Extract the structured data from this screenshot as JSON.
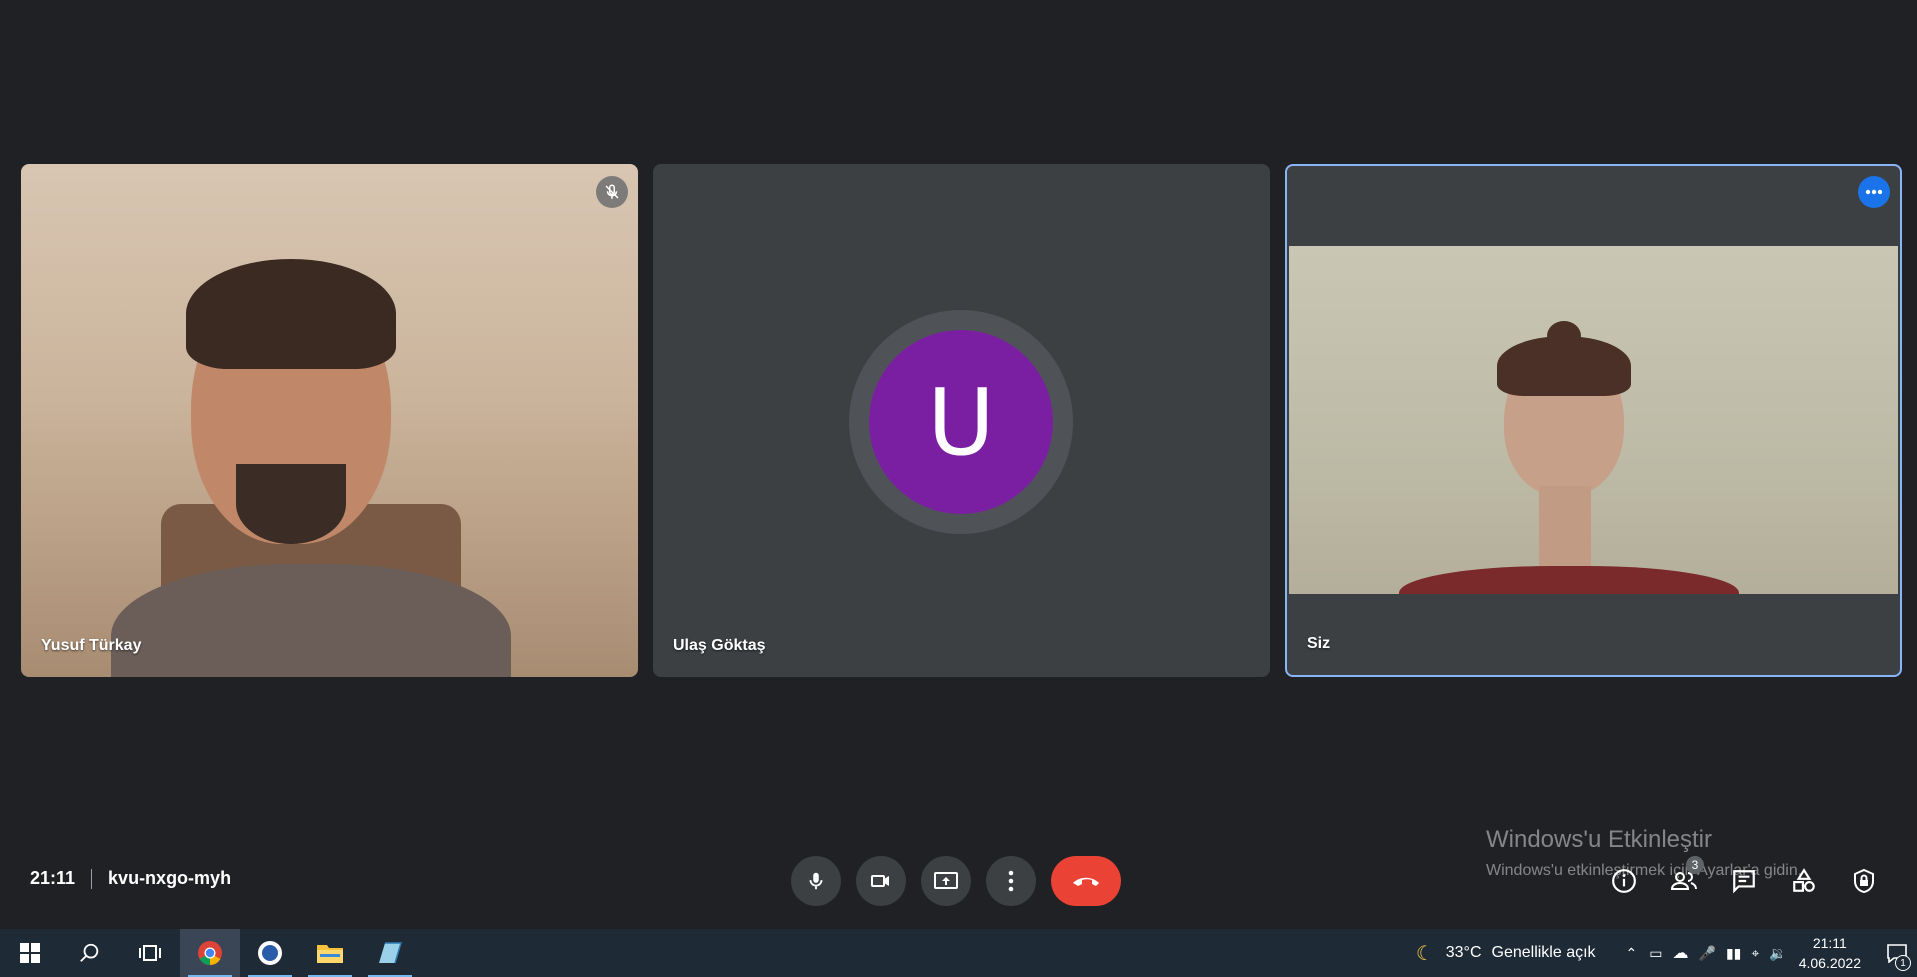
{
  "participants": [
    {
      "name": "Yusuf Türkay",
      "muted": true
    },
    {
      "name": "Ulaş Göktaş",
      "avatar_letter": "U",
      "avatar_color": "#7b1fa2"
    },
    {
      "name": "Siz",
      "highlighted": true
    }
  ],
  "meeting": {
    "time": "21:11",
    "code": "kvu-nxgo-myh"
  },
  "controls": [
    "microphone-icon",
    "camera-icon",
    "present-screen-icon",
    "more-options-icon",
    "hang-up-icon"
  ],
  "right_panel": {
    "participant_count": "3"
  },
  "watermark": {
    "title": "Windows'u Etkinleştir",
    "subtitle": "Windows'u etkinleştirmek için Ayarlar'a gidin."
  },
  "taskbar": {
    "weather_temp": "33°C",
    "weather_desc": "Genellikle açık",
    "clock_time": "21:11",
    "clock_date": "4.06.2022",
    "notification_count": "1"
  },
  "colors": {
    "background": "#202124",
    "tile": "#3c4043",
    "accent": "#8ab4f8",
    "hangup": "#ea4335"
  }
}
